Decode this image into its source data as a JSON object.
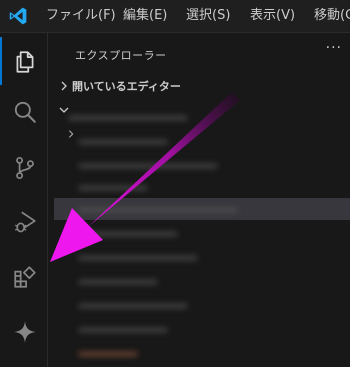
{
  "menu": {
    "items": [
      "ファイル(F)",
      "編集(E)",
      "選択(S)",
      "表示(V)",
      "移動(G"
    ]
  },
  "activity_bar": {
    "icons": [
      "explorer-icon",
      "search-icon",
      "source-control-icon",
      "run-debug-icon",
      "extensions-icon",
      "copilot-icon"
    ],
    "active": "explorer-icon"
  },
  "sidebar": {
    "title": "エクスプローラー",
    "more": "···",
    "sections": [
      {
        "label": "開いているエディター",
        "expanded": false
      }
    ]
  },
  "colors": {
    "background": "#181818",
    "titlebar": "#1f1f1f",
    "accent": "#0078d4",
    "logo": "#23a8f2",
    "arrow": "#e800e8"
  }
}
